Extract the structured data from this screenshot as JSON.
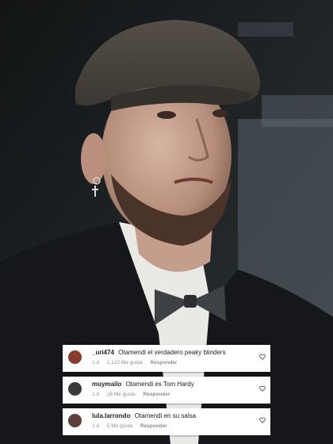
{
  "comments": [
    {
      "username": "_uri474",
      "text": "Otamendi el verdadero peaky blinders",
      "time": "1 d",
      "likes": "1.122 Me gusta",
      "reply": "Responder",
      "avatar_color": "#8a3a2a"
    },
    {
      "username": "muymailo",
      "text": "Otamendi es Tom Hardy",
      "time": "1 d",
      "likes": "26 Me gusta",
      "reply": "Responder",
      "avatar_color": "#3a3a3a"
    },
    {
      "username": "lula.larrondo",
      "text": "Otamendi en su salsa",
      "time": "1 d",
      "likes": "5 Me gusta",
      "reply": "Responder",
      "avatar_color": "#5a4038"
    }
  ],
  "colors": {
    "panel": "#ffffff",
    "muted": "#8e8e8e"
  }
}
